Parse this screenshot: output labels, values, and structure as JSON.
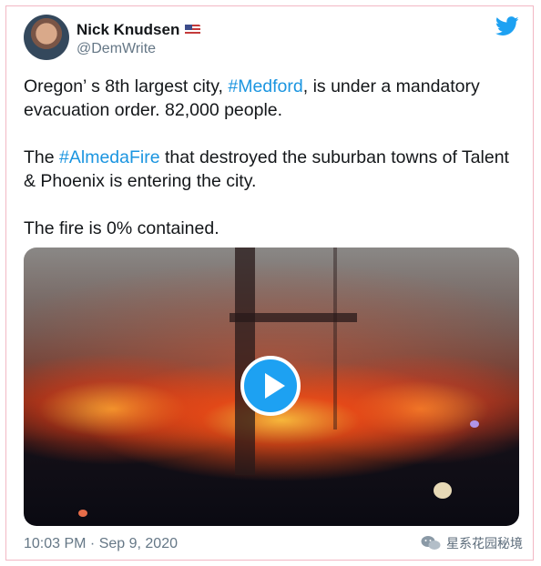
{
  "author": {
    "name": "Nick Knudsen",
    "handle": "@DemWrite",
    "flag_icon": "us-flag-emoji"
  },
  "tweet": {
    "p1_pre": "Oregon’ s 8th largest city, ",
    "p1_tag": "#Medford",
    "p1_post": ", is under a mandatory evacuation order. 82,000 people.",
    "p2_pre": "The ",
    "p2_tag": "#AlmedaFire",
    "p2_post": " that destroyed the suburban towns of Talent & Phoenix is entering the city.",
    "p3": "The fire is 0% contained."
  },
  "media": {
    "type": "video",
    "play_icon": "play-icon"
  },
  "timestamp": "10:03 PM · Sep 9, 2020",
  "watermark": "星系花园秘境",
  "colors": {
    "link": "#1b95e0",
    "twitter_blue": "#1da1f2",
    "text": "#14171a",
    "secondary": "#657786"
  }
}
